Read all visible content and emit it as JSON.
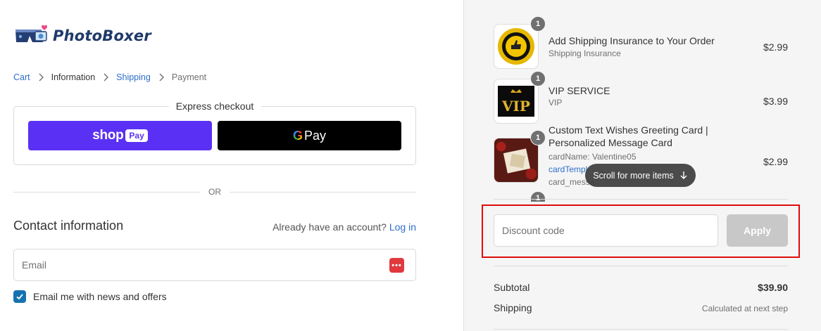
{
  "brand": {
    "name": "PhotoBoxer",
    "color": "#1f3a6b"
  },
  "breadcrumb": [
    {
      "label": "Cart",
      "state": "link"
    },
    {
      "label": "Information",
      "state": "current"
    },
    {
      "label": "Shipping",
      "state": "link"
    },
    {
      "label": "Payment",
      "state": "muted"
    }
  ],
  "express": {
    "title": "Express checkout",
    "shop_pay": {
      "word": "shop",
      "badge": "Pay",
      "color": "#5a31f4"
    },
    "google_pay": {
      "g": "G",
      "label": "Pay"
    }
  },
  "or_label": "OR",
  "contact": {
    "title": "Contact information",
    "account_prompt": "Already have an account?",
    "login_link": "Log in",
    "email_placeholder": "Email",
    "email_value": "",
    "newsletter_label": "Email me with news and offers",
    "newsletter_checked": true
  },
  "items": [
    {
      "name": "Add Shipping Insurance to Your Order",
      "sub": [
        "Shipping Insurance"
      ],
      "price": "$2.99",
      "qty": "1"
    },
    {
      "name": "VIP SERVICE",
      "sub": [
        "VIP"
      ],
      "price": "$3.99",
      "qty": "1"
    },
    {
      "name": "Custom Text Wishes Greeting Card | Personalized Message Card",
      "sub": [
        "cardName: Valentine05",
        "cardTempl",
        "card_messa"
      ],
      "price": "$2.99",
      "qty": "1"
    },
    {
      "qty": "1"
    }
  ],
  "scroll_hint": "Scroll for more items",
  "discount": {
    "placeholder": "Discount code",
    "value": "",
    "apply_label": "Apply"
  },
  "summary": {
    "subtotal_label": "Subtotal",
    "subtotal_value": "$39.90",
    "shipping_label": "Shipping",
    "shipping_value": "Calculated at next step"
  },
  "colors": {
    "link": "#2c6ecb",
    "highlight": "#e00b0b",
    "checkbox": "#1773b0"
  }
}
